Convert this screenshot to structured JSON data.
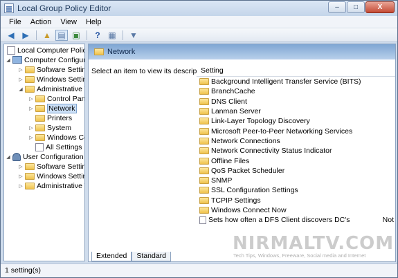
{
  "window": {
    "title": "Local Group Policy Editor",
    "buttons": [
      "–",
      "□",
      "X"
    ]
  },
  "menu": [
    "File",
    "Action",
    "View",
    "Help"
  ],
  "tree": {
    "root": "Local Computer Policy",
    "computer": "Computer Configura",
    "software": "Software Settings",
    "windows": "Windows Setting",
    "admin": "Administrative Te",
    "control": "Control Panel",
    "network": "Network",
    "printers": "Printers",
    "system": "System",
    "wincomp": "Windows Con",
    "allsettings": "All Settings",
    "user": "User Configuration",
    "usoftware": "Software Settings",
    "uwindows": "Windows Setting",
    "uadmin": "Administrative Te"
  },
  "right": {
    "header": "Network",
    "description": "Select an item to view its description.",
    "column_setting": "Setting",
    "items": [
      "Background Intelligent Transfer Service (BITS)",
      "BranchCache",
      "DNS Client",
      "Lanman Server",
      "Link-Layer Topology Discovery",
      "Microsoft Peer-to-Peer Networking Services",
      "Network Connections",
      "Network Connectivity Status Indicator",
      "Offline Files",
      "QoS Packet Scheduler",
      "SNMP",
      "SSL Configuration Settings",
      "TCPIP Settings",
      "Windows Connect Now"
    ],
    "policy_item": "Sets how often a DFS Client discovers DC's",
    "policy_state": "Not",
    "tabs": [
      "Extended",
      "Standard"
    ]
  },
  "status": "1 setting(s)",
  "watermark": {
    "brand": "NIRMALTV.COM",
    "tagline": "Tech Tips, Windows, Freeware, Social media and Internet"
  }
}
